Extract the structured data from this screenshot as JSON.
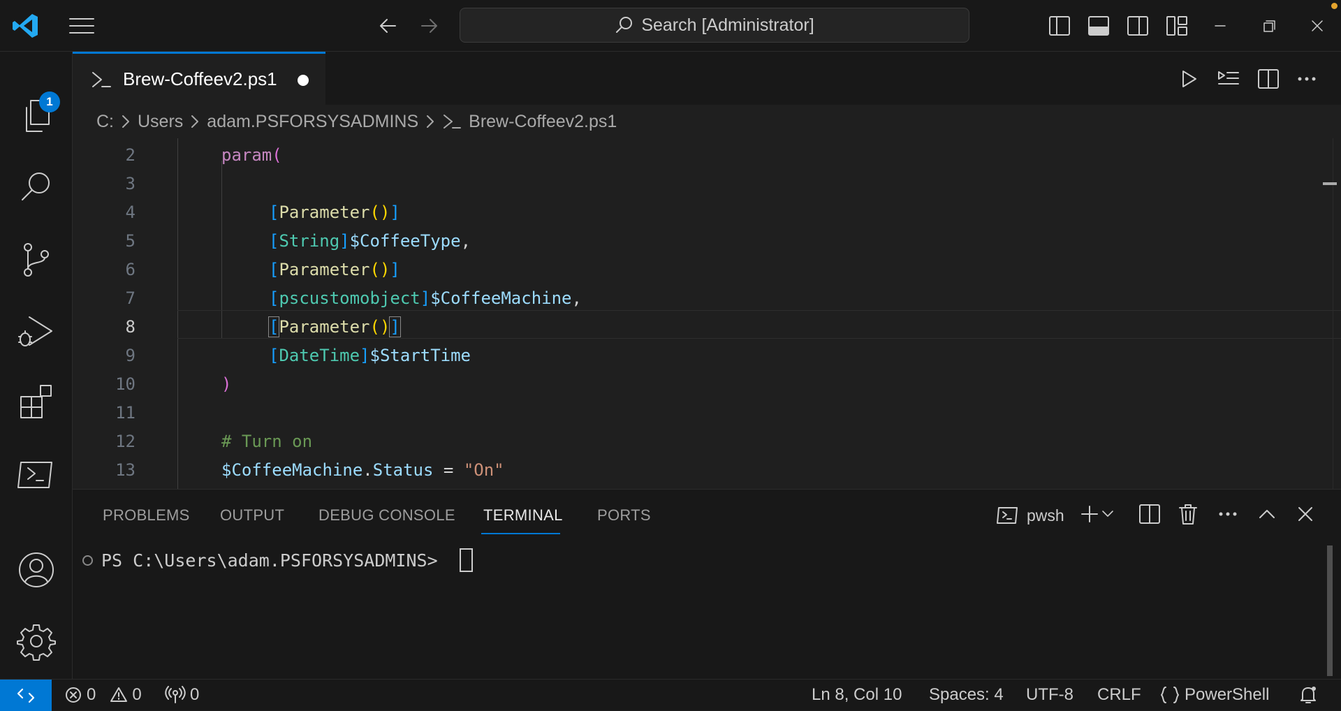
{
  "titlebar": {
    "search_text": "Search [Administrator]",
    "accent_color": "#0078d4"
  },
  "activitybar": {
    "items": [
      {
        "name": "explorer",
        "icon": "files-icon",
        "badge": "1"
      },
      {
        "name": "search",
        "icon": "search-icon"
      },
      {
        "name": "source-control",
        "icon": "source-control-icon"
      },
      {
        "name": "run-and-debug",
        "icon": "run-debug-icon"
      },
      {
        "name": "extensions",
        "icon": "extensions-icon"
      },
      {
        "name": "powershell",
        "icon": "terminal-icon"
      }
    ],
    "bottom_items": [
      {
        "name": "accounts",
        "icon": "account-icon"
      },
      {
        "name": "manage",
        "icon": "gear-icon"
      }
    ]
  },
  "editor": {
    "tab": {
      "title": "Brew-Coffeev2.ps1",
      "modified": true
    },
    "breadcrumb": [
      "C:",
      "Users",
      "adam.PSFORSYSADMINS",
      "Brew-Coffeev2.ps1"
    ],
    "current_line": 8,
    "lines": [
      {
        "num": "2",
        "text": "param("
      },
      {
        "num": "3",
        "text": ""
      },
      {
        "num": "4",
        "text": "[Parameter()]"
      },
      {
        "num": "5",
        "text": "[String]$CoffeeType,"
      },
      {
        "num": "6",
        "text": "[Parameter()]"
      },
      {
        "num": "7",
        "text": "[pscustomobject]$CoffeeMachine,"
      },
      {
        "num": "8",
        "text": "[Parameter()]"
      },
      {
        "num": "9",
        "text": "[DateTime]$StartTime"
      },
      {
        "num": "10",
        "text": ")"
      },
      {
        "num": "11",
        "text": ""
      },
      {
        "num": "12",
        "text": "# Turn on"
      },
      {
        "num": "13",
        "text": "$CoffeeMachine.Status = \"On\""
      }
    ]
  },
  "panel": {
    "tabs": [
      "PROBLEMS",
      "OUTPUT",
      "DEBUG CONSOLE",
      "TERMINAL",
      "PORTS"
    ],
    "active_tab": "TERMINAL",
    "terminal_shell": "pwsh",
    "terminal_prompt": "PS C:\\Users\\adam.PSFORSYSADMINS> "
  },
  "statusbar": {
    "errors": "0",
    "warnings": "0",
    "ports": "0",
    "position": "Ln 8, Col 10",
    "spaces": "Spaces: 4",
    "encoding": "UTF-8",
    "eol": "CRLF",
    "language": "PowerShell"
  }
}
